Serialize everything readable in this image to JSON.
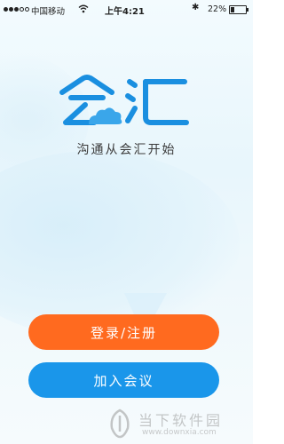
{
  "status_bar": {
    "carrier": "中国移动",
    "time": "上午4:21",
    "bluetooth": "✱",
    "battery_percent": "22%",
    "battery_level": 0.22,
    "icons": [
      "signal-dots-icon",
      "wifi-icon",
      "bluetooth-icon",
      "battery-icon"
    ]
  },
  "logo": {
    "text": "会汇",
    "colors": {
      "primary": "#1a8fe0",
      "cloud": "#3aa6ea"
    }
  },
  "slogan": "沟通从会汇开始",
  "buttons": {
    "login_label": "登录/注册",
    "login_color": "#ff6a1f",
    "join_label": "加入会议",
    "join_color": "#1a96ea"
  },
  "watermark": {
    "title": "当下软件园",
    "url": "www.downxia.com"
  }
}
